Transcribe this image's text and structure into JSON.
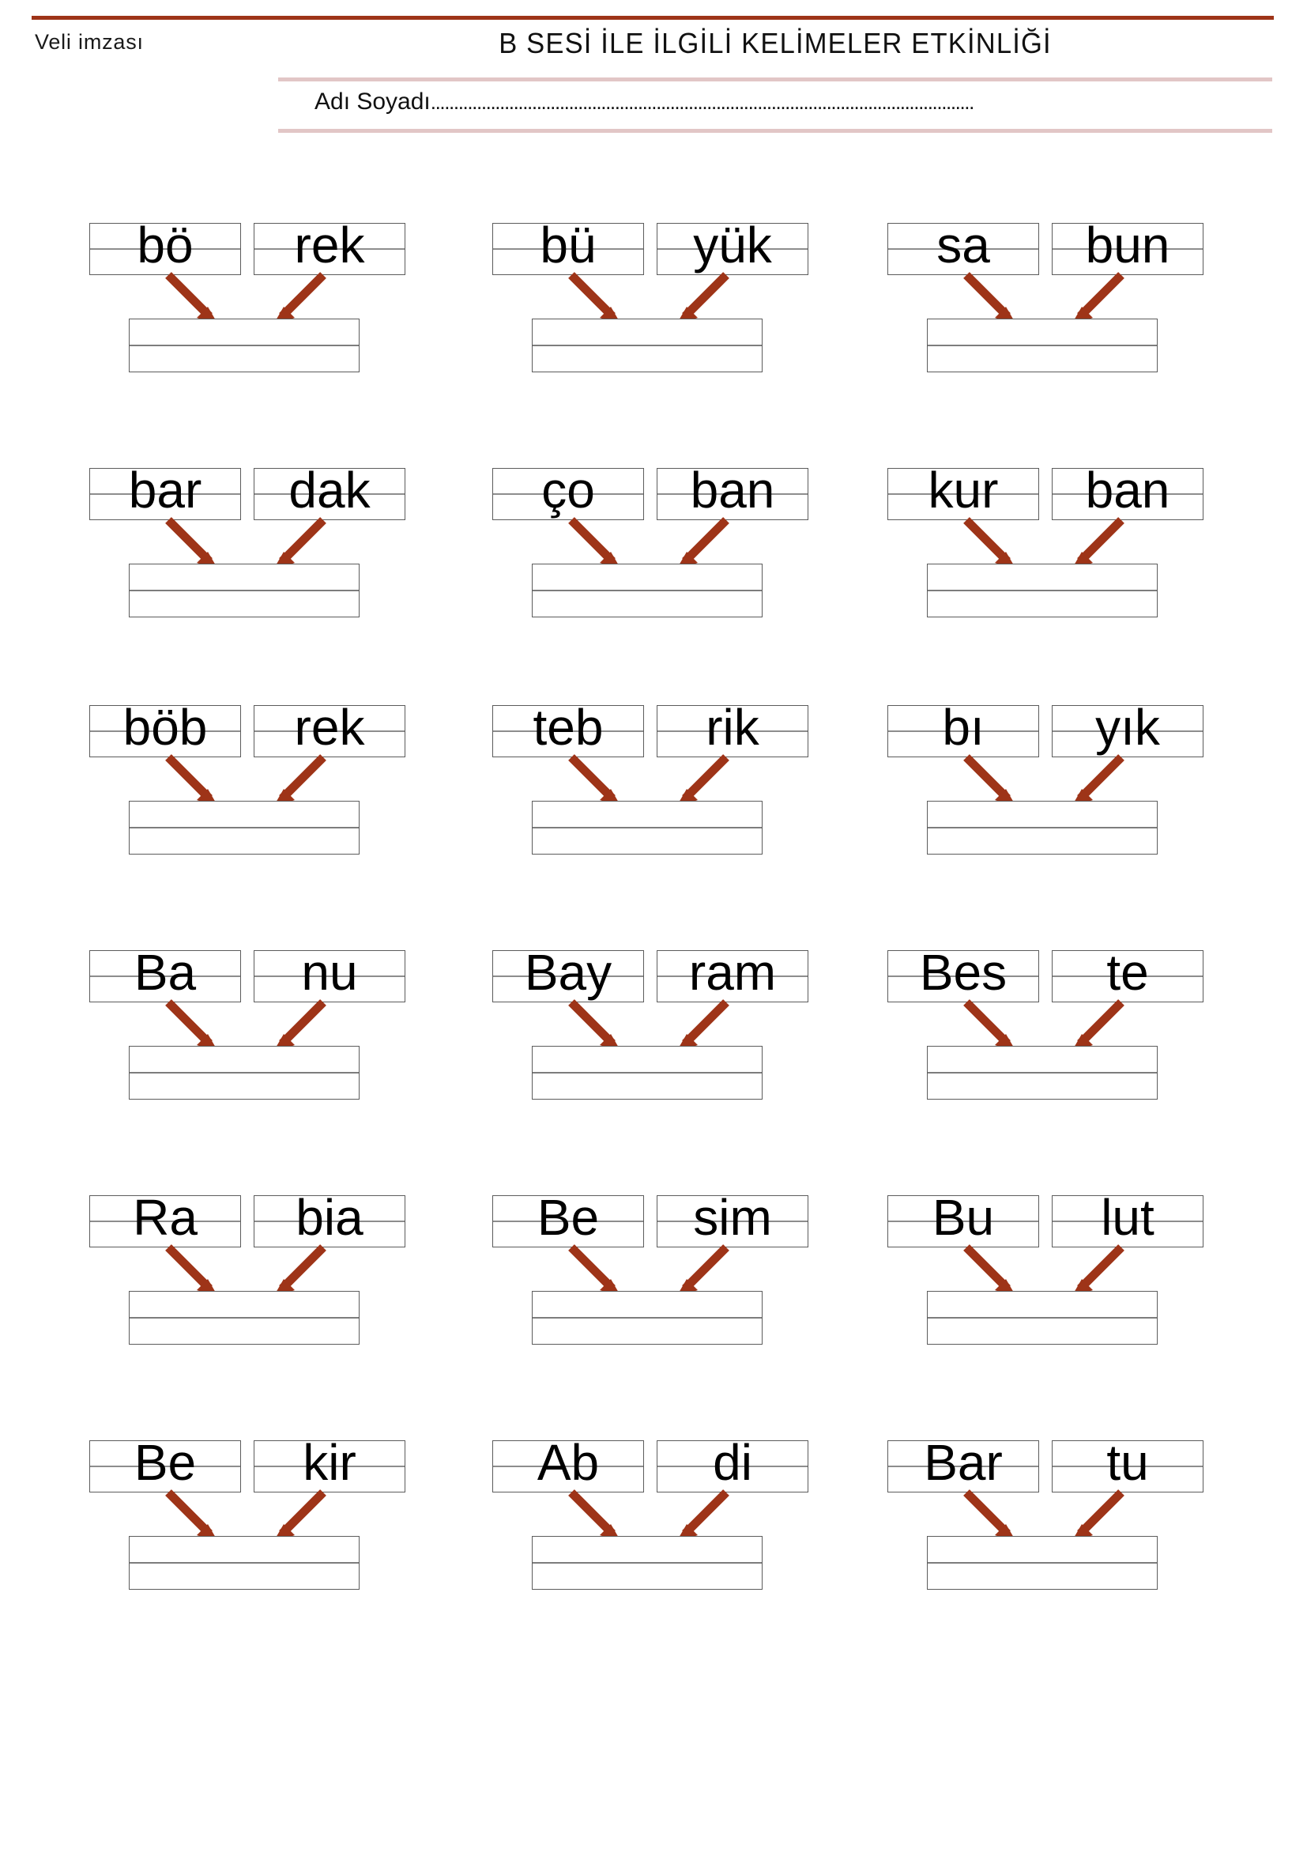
{
  "header": {
    "parent_signature_label": "Veli imzası",
    "title": "B SESİ İLE İLGİLİ KELİMELER ETKİNLİĞİ",
    "name_label": "Adı Soyadı",
    "name_dots": "......................................................................................................................",
    "name_value": "",
    "rule_color_top": "#9E3418",
    "rule_color_accent": "#E2C6C6"
  },
  "colors": {
    "arrow": "#9E3418",
    "box_border": "#5c5c5c",
    "midline": "#8d8d8d",
    "text": "#000000"
  },
  "exercises": [
    {
      "first": "bö",
      "second": "rek"
    },
    {
      "first": "bü",
      "second": "yük"
    },
    {
      "first": "sa",
      "second": "bun"
    },
    {
      "first": "bar",
      "second": "dak"
    },
    {
      "first": "ço",
      "second": "ban"
    },
    {
      "first": "kur",
      "second": "ban"
    },
    {
      "first": "böb",
      "second": "rek"
    },
    {
      "first": "teb",
      "second": "rik"
    },
    {
      "first": "bı",
      "second": "yık"
    },
    {
      "first": "Ba",
      "second": "nu"
    },
    {
      "first": "Bay",
      "second": "ram"
    },
    {
      "first": "Bes",
      "second": "te"
    },
    {
      "first": "Ra",
      "second": "bia"
    },
    {
      "first": "Be",
      "second": "sim"
    },
    {
      "first": "Bu",
      "second": "lut"
    },
    {
      "first": "Be",
      "second": "kir"
    },
    {
      "first": "Ab",
      "second": "di"
    },
    {
      "first": "Bar",
      "second": "tu"
    }
  ],
  "answers": [
    "",
    "",
    "",
    "",
    "",
    "",
    "",
    "",
    "",
    "",
    "",
    "",
    "",
    "",
    "",
    "",
    "",
    ""
  ]
}
